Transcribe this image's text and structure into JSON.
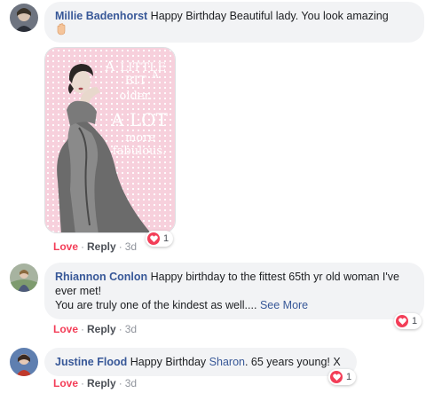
{
  "comments": [
    {
      "author": "Millie Badenhorst",
      "text": " Happy Birthday Beautiful lady. You look amazing",
      "emoji_icon": "raised-hand-emoji",
      "image": {
        "lines": [
          "A",
          "LITTLE BIT",
          "older.",
          "A LOT",
          "more",
          "fabulous."
        ],
        "background_color": "#f7d0dc"
      },
      "actions": {
        "love": "Love",
        "reply": "Reply",
        "time": "3d"
      },
      "reaction_count": "1"
    },
    {
      "author": "Rhiannon Conlon",
      "text": " Happy birthday to the fittest 65th yr old woman I've ever met!",
      "text2": "You are truly one of the kindest as well....",
      "see_more": "See More",
      "actions": {
        "love": "Love",
        "reply": "Reply",
        "time": "3d"
      },
      "reaction_count": "1"
    },
    {
      "author": "Justine Flood",
      "text_before": " Happy Birthday ",
      "mention": "Sharon",
      "text_after": ". 65 years young! X",
      "actions": {
        "love": "Love",
        "reply": "Reply",
        "time": "3d"
      },
      "reaction_count": "1"
    }
  ],
  "colors": {
    "author_link": "#385898",
    "love": "#f33e58",
    "bubble": "#f2f3f5"
  }
}
